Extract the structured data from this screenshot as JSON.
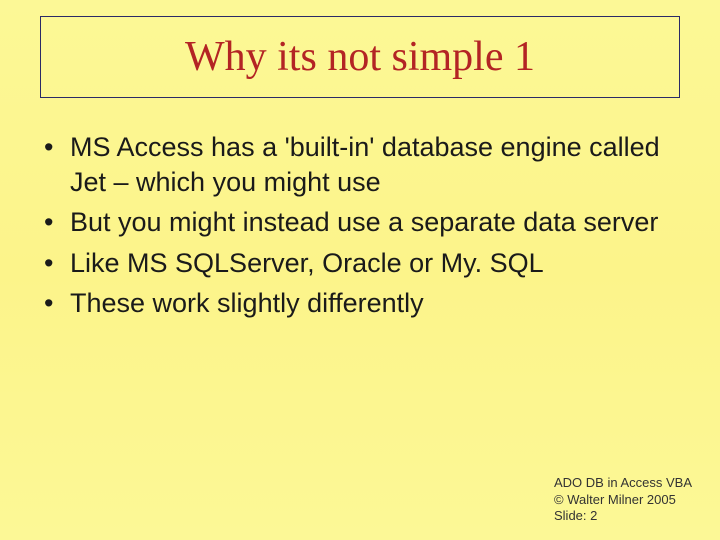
{
  "title": "Why its not simple 1",
  "bullets": [
    "MS Access has a 'built-in' database engine called Jet – which you might use",
    "But you might instead use a separate data server",
    "Like MS SQLServer, Oracle or  My. SQL",
    "These work slightly differently"
  ],
  "footer": {
    "line1": "ADO DB in Access VBA",
    "line2": "© Walter Milner 2005",
    "line3": "Slide: 2"
  }
}
